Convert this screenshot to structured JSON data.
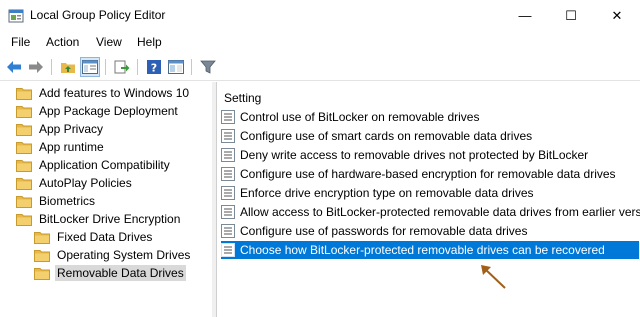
{
  "window": {
    "title": "Local Group Policy Editor",
    "min_glyph": "—",
    "max_glyph": "☐",
    "close_glyph": "✕"
  },
  "menu": [
    "File",
    "Action",
    "View",
    "Help"
  ],
  "toolbar": {
    "icons": [
      "back-arrow-icon",
      "forward-arrow-icon",
      "up-folder-icon",
      "show-hide-tree-icon",
      "export-list-icon",
      "help-icon",
      "properties-view-icon",
      "filter-icon"
    ]
  },
  "tree": {
    "items": [
      {
        "label": "Add features to Windows 10",
        "level": 0
      },
      {
        "label": "App Package Deployment",
        "level": 0
      },
      {
        "label": "App Privacy",
        "level": 0
      },
      {
        "label": "App runtime",
        "level": 0
      },
      {
        "label": "Application Compatibility",
        "level": 0
      },
      {
        "label": "AutoPlay Policies",
        "level": 0
      },
      {
        "label": "Biometrics",
        "level": 0
      },
      {
        "label": "BitLocker Drive Encryption",
        "level": 0
      },
      {
        "label": "Fixed Data Drives",
        "level": 1
      },
      {
        "label": "Operating System Drives",
        "level": 1
      },
      {
        "label": "Removable Data Drives",
        "level": 1,
        "selected": true
      }
    ]
  },
  "list": {
    "header": "Setting",
    "rows": [
      {
        "label": "Control use of BitLocker on removable drives"
      },
      {
        "label": "Configure use of smart cards on removable data drives"
      },
      {
        "label": "Deny write access to removable drives not protected by BitLocker"
      },
      {
        "label": "Configure use of hardware-based encryption for removable data drives"
      },
      {
        "label": "Enforce drive encryption type on removable data drives"
      },
      {
        "label": "Allow access to BitLocker-protected removable data drives from earlier versions of Windows"
      },
      {
        "label": "Configure use of passwords for removable data drives"
      },
      {
        "label": "Choose how BitLocker-protected removable drives can be recovered",
        "selected": true
      }
    ]
  },
  "colors": {
    "selection": "#0078d7",
    "folder": "#e8b84a",
    "annotation_arrow": "#a0601a"
  }
}
